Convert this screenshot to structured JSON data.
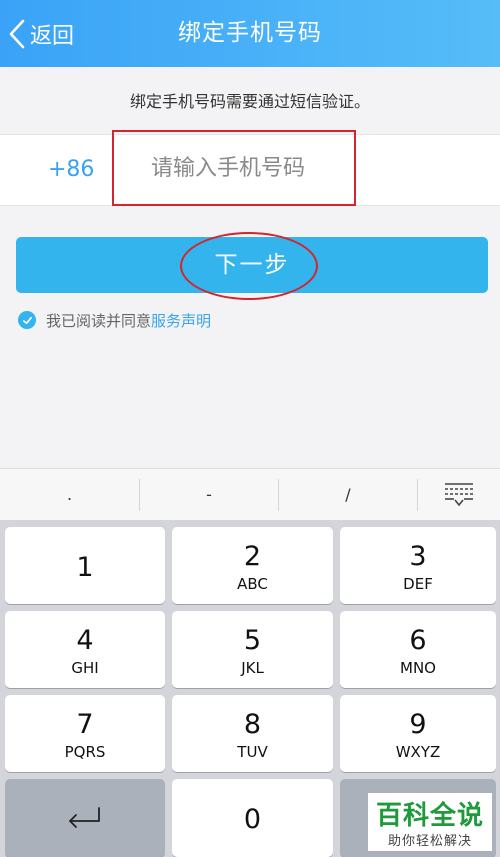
{
  "header": {
    "back_label": "返回",
    "title": "绑定手机号码"
  },
  "notice": "绑定手机号码需要通过短信验证。",
  "phone": {
    "country_code": "+86",
    "value": "",
    "placeholder": "请输入手机号码"
  },
  "next_button": "下一步",
  "agreement": {
    "checked": true,
    "text": "我已阅读并同意",
    "link": "服务声明"
  },
  "keyboard": {
    "symbols": [
      ".",
      "-",
      "/"
    ],
    "keys": [
      {
        "num": "1",
        "letters": ""
      },
      {
        "num": "2",
        "letters": "ABC"
      },
      {
        "num": "3",
        "letters": "DEF"
      },
      {
        "num": "4",
        "letters": "GHI"
      },
      {
        "num": "5",
        "letters": "JKL"
      },
      {
        "num": "6",
        "letters": "MNO"
      },
      {
        "num": "7",
        "letters": "PQRS"
      },
      {
        "num": "8",
        "letters": "TUV"
      },
      {
        "num": "9",
        "letters": "WXYZ"
      },
      {
        "num": "0",
        "letters": ""
      }
    ]
  },
  "watermark": {
    "title": "百科全说",
    "subtitle": "助你轻松解决"
  },
  "colors": {
    "accent": "#33b4ec",
    "header": "#3aa3f7",
    "highlight": "#d5242d"
  }
}
